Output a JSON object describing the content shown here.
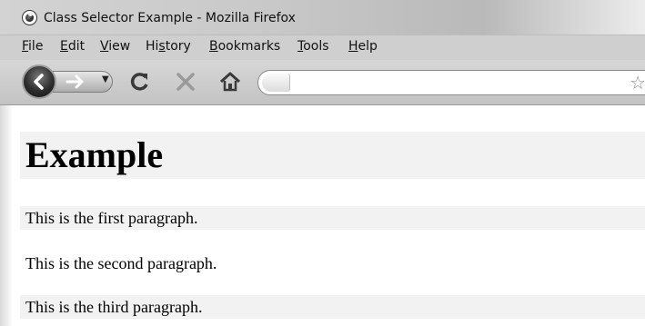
{
  "window": {
    "title": "Class Selector Example - Mozilla Firefox",
    "app_icon": "firefox-icon"
  },
  "menubar": {
    "items": [
      {
        "label": "File",
        "accesskey": "F"
      },
      {
        "label": "Edit",
        "accesskey": "E"
      },
      {
        "label": "View",
        "accesskey": "V"
      },
      {
        "label": "History",
        "accesskey": "s"
      },
      {
        "label": "Bookmarks",
        "accesskey": "B"
      },
      {
        "label": "Tools",
        "accesskey": "T"
      },
      {
        "label": "Help",
        "accesskey": "H"
      }
    ]
  },
  "toolbar": {
    "buttons": [
      "back-icon",
      "forward-icon",
      "dropdown-icon",
      "reload-icon",
      "stop-icon",
      "home-icon"
    ],
    "url_value": "",
    "bookmark_icon": "star-icon"
  },
  "page": {
    "heading": "Example",
    "paragraphs": [
      {
        "text": "This is the first paragraph.",
        "shaded": true
      },
      {
        "text": "This is the second paragraph.",
        "shaded": false
      },
      {
        "text": "This is the third paragraph.",
        "shaded": true
      }
    ],
    "highlight_color": "#f2f2f2"
  }
}
